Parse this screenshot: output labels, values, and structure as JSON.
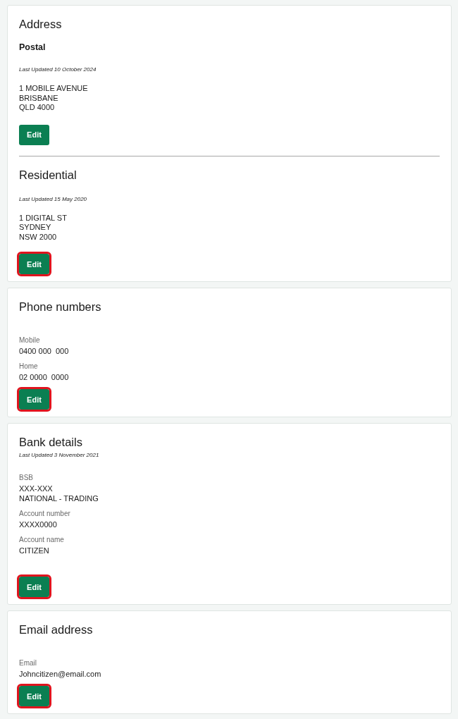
{
  "cards": [
    {
      "title": "Address",
      "items": [
        {
          "kind": "subtitle",
          "text": "Postal"
        },
        {
          "kind": "updated",
          "text": "Last Updated 10 October 2024"
        },
        {
          "kind": "address",
          "lines": [
            "1 MOBILE AVENUE",
            "BRISBANE",
            "QLD 4000"
          ]
        },
        {
          "kind": "button",
          "label": "Edit",
          "highlighted": false
        },
        {
          "kind": "divider"
        },
        {
          "kind": "section_title",
          "text": "Residential"
        },
        {
          "kind": "updated",
          "text": "Last Updated 15 May 2020"
        },
        {
          "kind": "address",
          "lines": [
            "1 DIGITAL ST",
            "SYDNEY",
            "NSW 2000"
          ]
        },
        {
          "kind": "button",
          "label": "Edit",
          "highlighted": true
        }
      ]
    },
    {
      "title": "Phone numbers",
      "items": [
        {
          "kind": "field",
          "label": "Mobile",
          "values": [
            "0400 000  000"
          ]
        },
        {
          "kind": "field",
          "label": "Home",
          "values": [
            "02 0000  0000"
          ]
        },
        {
          "kind": "button",
          "label": "Edit",
          "highlighted": true
        }
      ]
    },
    {
      "title": "Bank details",
      "items": [
        {
          "kind": "updated",
          "text": "Last Updated 3 November 2021"
        },
        {
          "kind": "field",
          "label": "BSB",
          "values": [
            "XXX-XXX",
            "NATIONAL - TRADING"
          ]
        },
        {
          "kind": "field",
          "label": "Account number",
          "values": [
            "XXXX0000"
          ]
        },
        {
          "kind": "field",
          "label": "Account name",
          "values": [
            "CITIZEN"
          ]
        },
        {
          "kind": "button",
          "label": "Edit",
          "highlighted": true
        }
      ]
    },
    {
      "title": "Email address",
      "items": [
        {
          "kind": "field",
          "label": "Email",
          "values": [
            "Johncitizen@email.com"
          ]
        },
        {
          "kind": "button",
          "label": "Edit",
          "highlighted": true
        }
      ]
    }
  ]
}
